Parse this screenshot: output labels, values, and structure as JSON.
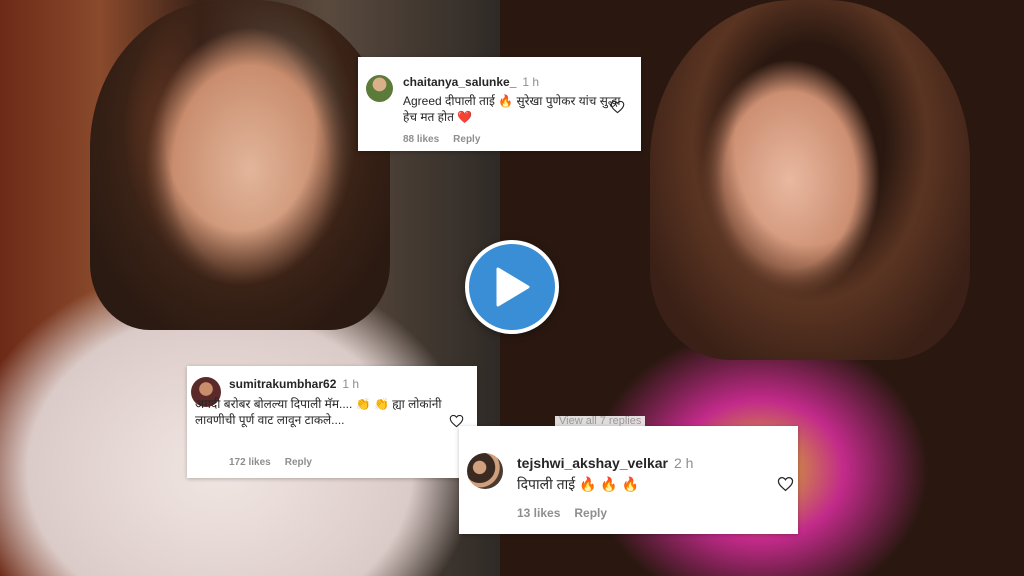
{
  "comments": [
    {
      "username": "chaitanya_salunke_",
      "time": "1 h",
      "text": "Agreed दीपाली ताई 🔥 सुरेखा पुणेकर यांच सुद्धा हेच मत होत ❤️",
      "likes": "88 likes",
      "reply": "Reply"
    },
    {
      "username": "sumitrakumbhar62",
      "time": "1 h",
      "text": "अगदी बरोबर बोलल्या दिपाली मॅम.... 👏 👏 ह्या लोकांनी लावणीची पूर्ण वाट लावून टाकले....",
      "likes": "172 likes",
      "reply": "Reply"
    },
    {
      "username": "tejshwi_akshay_velkar",
      "time": "2 h",
      "text": "दिपाली ताई 🔥 🔥 🔥",
      "likes": "13 likes",
      "reply": "Reply"
    }
  ],
  "view_replies": "View all 7 replies",
  "icons": {
    "play": "play-icon",
    "heart": "heart-icon"
  },
  "colors": {
    "play_button": "#3a8ed6",
    "meta_text": "#8e8e8e"
  }
}
